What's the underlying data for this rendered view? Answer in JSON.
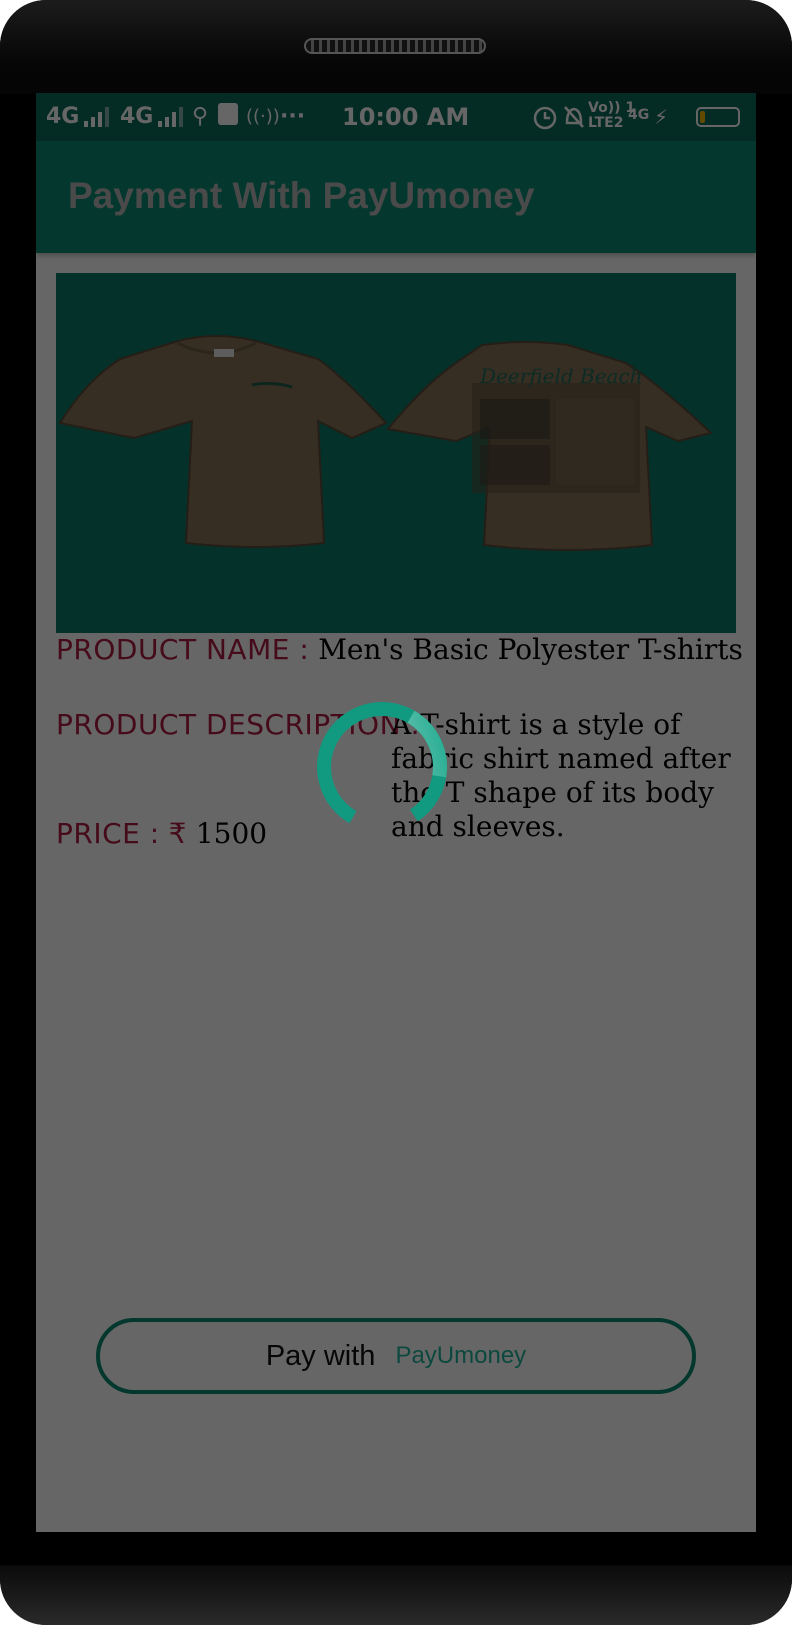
{
  "status_bar": {
    "network1": "4G",
    "network2": "4G",
    "time": "10:00 AM",
    "volte": "Vo)) 1",
    "lte": "LTE2",
    "network3": "4G",
    "battery_level": 0.15
  },
  "app_bar": {
    "title": "Payment With PayUmoney"
  },
  "product": {
    "name_label": "PRODUCT NAME :",
    "name_value": "Men's Basic Polyester T-shirts",
    "description_label": "PRODUCT DESCRIPTION :",
    "description_value": "A T-shirt is a style of fabric shirt named after the T shape of its body and sleeves.",
    "price_label": "PRICE :",
    "currency_symbol": "₹",
    "price_value": "1500",
    "image_print_text": "Deerfield Beach"
  },
  "pay_button": {
    "prefix": "Pay with",
    "brand": "PayUmoney"
  },
  "colors": {
    "primary": "#0c8b74",
    "status_bar": "#0a6b5a",
    "label": "#b01c43",
    "shirt": "#8a7358"
  }
}
